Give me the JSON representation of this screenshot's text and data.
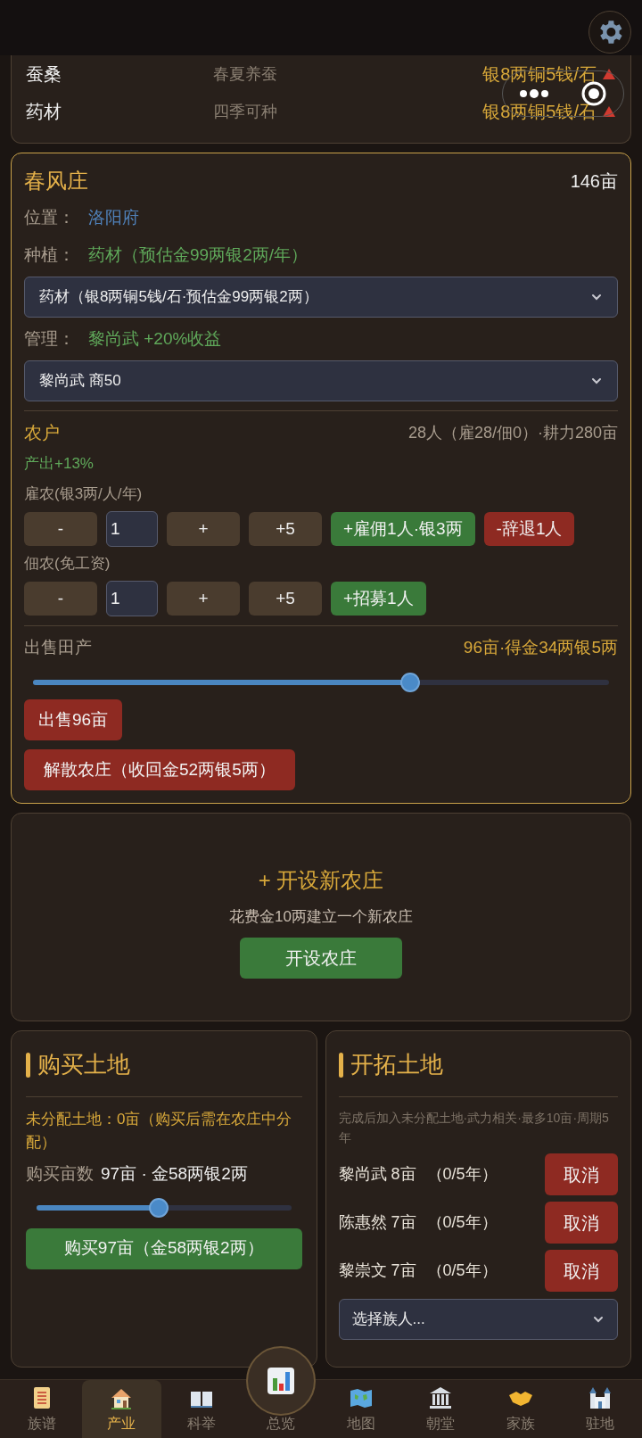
{
  "crop_table": {
    "rows": [
      {
        "name": "蚕桑",
        "season": "春夏养蚕",
        "price": "银8两铜5钱/石"
      },
      {
        "name": "药材",
        "season": "四季可种",
        "price": "银8两铜5钱/石"
      }
    ]
  },
  "farm": {
    "name": "春风庄",
    "area": "146亩",
    "location": {
      "label": "位置：",
      "value": "洛阳府"
    },
    "crop": {
      "label": "种植：",
      "value": "药材（预估金99两银2两/年）"
    },
    "crop_select": {
      "value": "药材（银8两铜5钱/石·预估金99两银2两）"
    },
    "manager": {
      "label": "管理：",
      "value": "黎尚武 +20%收益"
    },
    "manager_select": {
      "value": "黎尚武 商50"
    },
    "households": {
      "title": "农户",
      "summary": "28人（雇28/佃0）·耕力280亩",
      "bonus": "产出+13%",
      "groups": [
        {
          "label": "雇农(银3两/人/年)",
          "minus": "-",
          "value": "1",
          "plus": "+",
          "plus5": "+5",
          "actions": [
            {
              "label": "+雇佣1人·银3两",
              "kind": "add"
            },
            {
              "label": "-辞退1人",
              "kind": "remove"
            }
          ]
        },
        {
          "label": "佃农(免工资)",
          "minus": "-",
          "value": "1",
          "plus": "+",
          "plus5": "+5",
          "actions": [
            {
              "label": "+招募1人",
              "kind": "add"
            }
          ]
        }
      ]
    },
    "sell": {
      "title": "出售田产",
      "summary": "96亩·得金34两银5两",
      "level": 0.655,
      "button": "出售96亩"
    },
    "dissolve_button": "解散农庄（收回金52两银5两）"
  },
  "new_farm": {
    "title": "+ 开设新农庄",
    "description": "花费金10两建立一个新农庄",
    "button": "开设农庄"
  },
  "buy_land": {
    "title": "购买土地",
    "unassigned": "未分配土地：0亩（购买后需在农庄中分配）",
    "amount_label": "购买亩数",
    "amount": "97亩 · 金58两银2两",
    "level": 0.48,
    "button": "购买97亩（金58两银2两）"
  },
  "reclaim_land": {
    "title": "开拓土地",
    "note": "完成后加入未分配土地·武力相关·最多10亩·周期5年",
    "projects": [
      {
        "person": "黎尚武 8亩",
        "progress": "（0/5年）",
        "button": "取消"
      },
      {
        "person": "陈惠然 7亩",
        "progress": "（0/5年）",
        "button": "取消"
      },
      {
        "person": "黎崇文 7亩",
        "progress": "（0/5年）",
        "button": "取消"
      }
    ],
    "select_placeholder": "选择族人..."
  },
  "bottom_nav": {
    "items": [
      {
        "label": "族谱",
        "selected": false,
        "kind": "tab"
      },
      {
        "label": "产业",
        "selected": true,
        "kind": "tab"
      },
      {
        "label": "科举",
        "selected": false,
        "kind": "tab"
      },
      {
        "label": "总览",
        "selected": false,
        "kind": "center"
      },
      {
        "label": "地图",
        "selected": false,
        "kind": "tab"
      },
      {
        "label": "朝堂",
        "selected": false,
        "kind": "tab"
      },
      {
        "label": "家族",
        "selected": false,
        "kind": "tab"
      },
      {
        "label": "驻地",
        "selected": false,
        "kind": "tab"
      }
    ]
  }
}
